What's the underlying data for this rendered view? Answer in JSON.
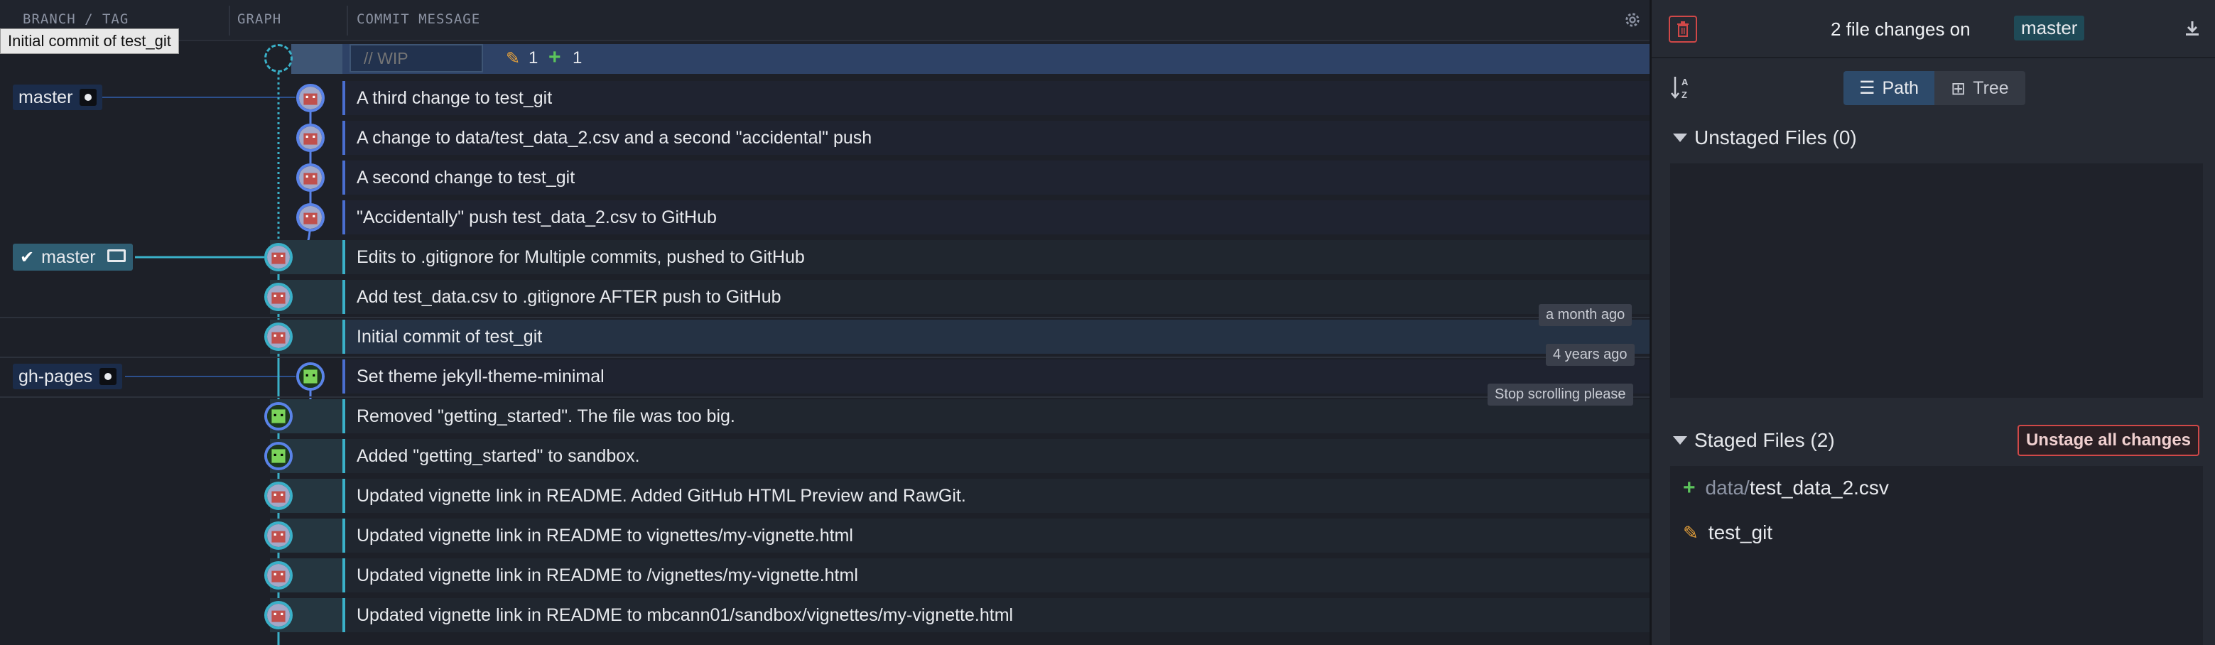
{
  "columns": {
    "branch_tag": "BRANCH / TAG",
    "graph": "GRAPH",
    "commit_message": "COMMIT MESSAGE"
  },
  "tooltip": "Initial commit of test_git",
  "wip": {
    "placeholder": "// WIP",
    "modified_count": "1",
    "added_count": "1"
  },
  "refs": {
    "master_remote": "master",
    "master_local": "master",
    "gh_pages": "gh-pages"
  },
  "commits": [
    "A third change to test_git",
    "A change to data/test_data_2.csv and a second \"accidental\" push",
    "A second change to test_git",
    "\"Accidentally\" push test_data_2.csv to GitHub",
    "Edits to .gitignore for Multiple commits, pushed to GitHub",
    "Add test_data.csv to .gitignore AFTER push to GitHub",
    "Initial commit of test_git",
    "Set theme jekyll-theme-minimal",
    "Removed \"getting_started\". The file was too big.",
    "Added \"getting_started\" to sandbox.",
    "Updated vignette link in README. Added GitHub HTML Preview and RawGit.",
    "Updated vignette link in README to vignettes/my-vignette.html",
    "Updated vignette link in README to /vignettes/my-vignette.html",
    "Updated vignette link in README to mbcann01/sandbox/vignettes/my-vignette.html"
  ],
  "time_tags": {
    "month": "a month ago",
    "years": "4 years ago",
    "stop": "Stop scrolling please"
  },
  "right_panel": {
    "summary_prefix": "2 file changes on",
    "branch": "master",
    "view_path": "Path",
    "view_tree": "Tree",
    "unstaged_title": "Unstaged Files (0)",
    "staged_title": "Staged Files (2)",
    "unstage_all": "Unstage all changes",
    "staged_files": [
      {
        "dir": "data/",
        "name": "test_data_2.csv",
        "status": "added"
      },
      {
        "dir": "",
        "name": "test_git",
        "status": "modified"
      }
    ]
  },
  "colors": {
    "accent_blue": "#5a83e8",
    "teal_branch": "#3ab0c8",
    "added_green": "#5cc45c",
    "modified_orange": "#e8a23a",
    "danger_red": "#d04848"
  }
}
